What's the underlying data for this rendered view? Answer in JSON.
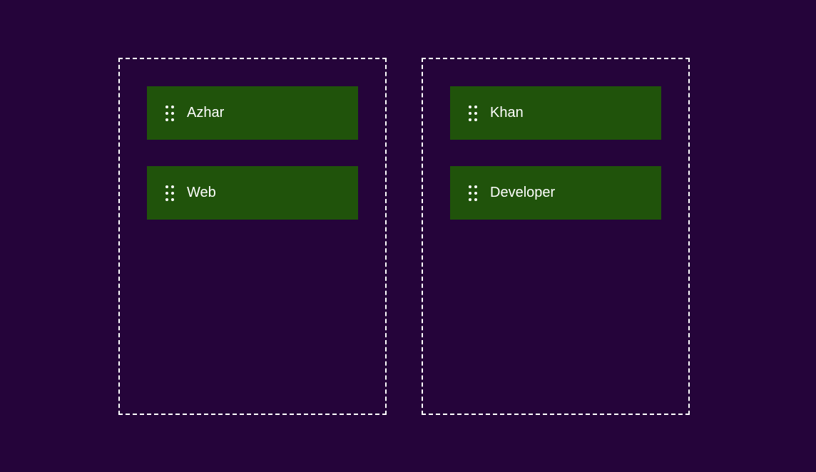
{
  "colors": {
    "background": "#25043a",
    "card": "#20530b",
    "text": "#ffffff",
    "border": "#ffffff"
  },
  "columns": [
    {
      "items": [
        {
          "label": "Azhar",
          "icon": "drag-handle-icon"
        },
        {
          "label": "Web",
          "icon": "drag-handle-icon"
        }
      ]
    },
    {
      "items": [
        {
          "label": "Khan",
          "icon": "drag-handle-icon"
        },
        {
          "label": "Developer",
          "icon": "drag-handle-icon"
        }
      ]
    }
  ]
}
